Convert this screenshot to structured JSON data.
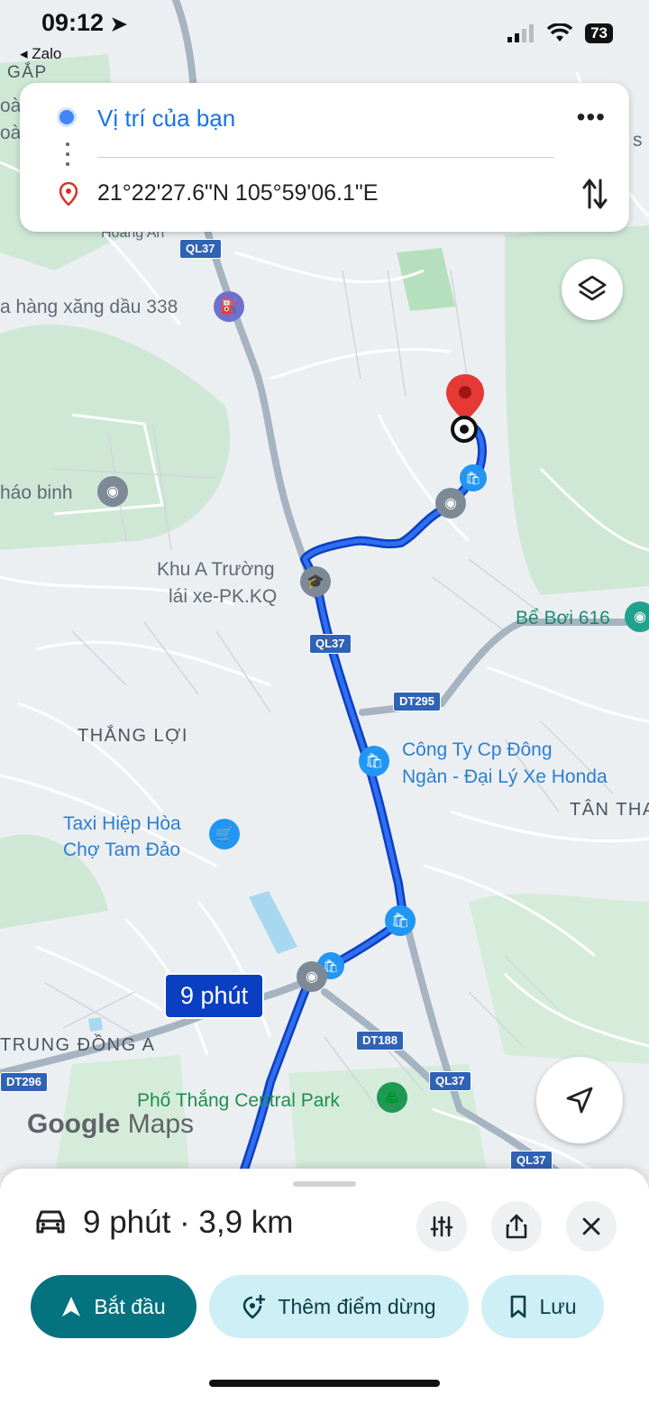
{
  "status_bar": {
    "time": "09:12",
    "back_app": "◂ Zalo",
    "battery": "73"
  },
  "route": {
    "origin": "Vị trí của bạn",
    "destination": "21°22'27.6\"N 105°59'06.1\"E"
  },
  "map": {
    "labels": {
      "gap": "GẮP",
      "oa1": "oàn",
      "oa2": "oà",
      "hoang_an": "Hoàng An",
      "s_edge": "s",
      "gas_station": "a hàng xăng dầu 338",
      "hao_binh": "háo binh",
      "driving_school_1": "Khu A Trường",
      "driving_school_2": "lái xe-PK.KQ",
      "be_boi": "Bể Bơi 616",
      "thang_loi": "THẮNG LỢI",
      "cong_ty_1": "Công Ty Cp Đông",
      "cong_ty_2": "Ngàn - Đại Lý Xe Honda",
      "tan_tha": "TÂN THA",
      "taxi_1": "Taxi Hiệp Hòa",
      "taxi_2": "Chợ Tam Đảo",
      "trung_dong": "TRUNG ĐỒNG A",
      "central_park": "Phố Thắng Central Park"
    },
    "shields": {
      "ql37_a": "QL37",
      "ql37_b": "QL37",
      "dt295": "DT295",
      "dt188": "DT188",
      "dt296": "DT296",
      "ql37_c": "QL37",
      "ql37_d": "QL37"
    },
    "eta_badge": "9 phút",
    "logo_brand": "Google",
    "logo_product": "Maps"
  },
  "sheet": {
    "summary": "9 phút · 3,9 km",
    "start_label": "Bắt đầu",
    "add_stop_label": "Thêm điểm dừng",
    "save_label": "Lưu"
  },
  "icons": {
    "more": "more-options-icon",
    "swap": "swap-icon",
    "layers": "layers-icon",
    "locate": "navigation-arrow-icon",
    "car": "car-icon",
    "options": "route-options-icon",
    "share": "share-icon",
    "close": "close-icon"
  },
  "colors": {
    "route": "#0b3fc1",
    "accent": "#1a73e8",
    "start_button": "#04727f",
    "secondary_button": "#cdeff5",
    "destination_pin": "#e53935"
  }
}
